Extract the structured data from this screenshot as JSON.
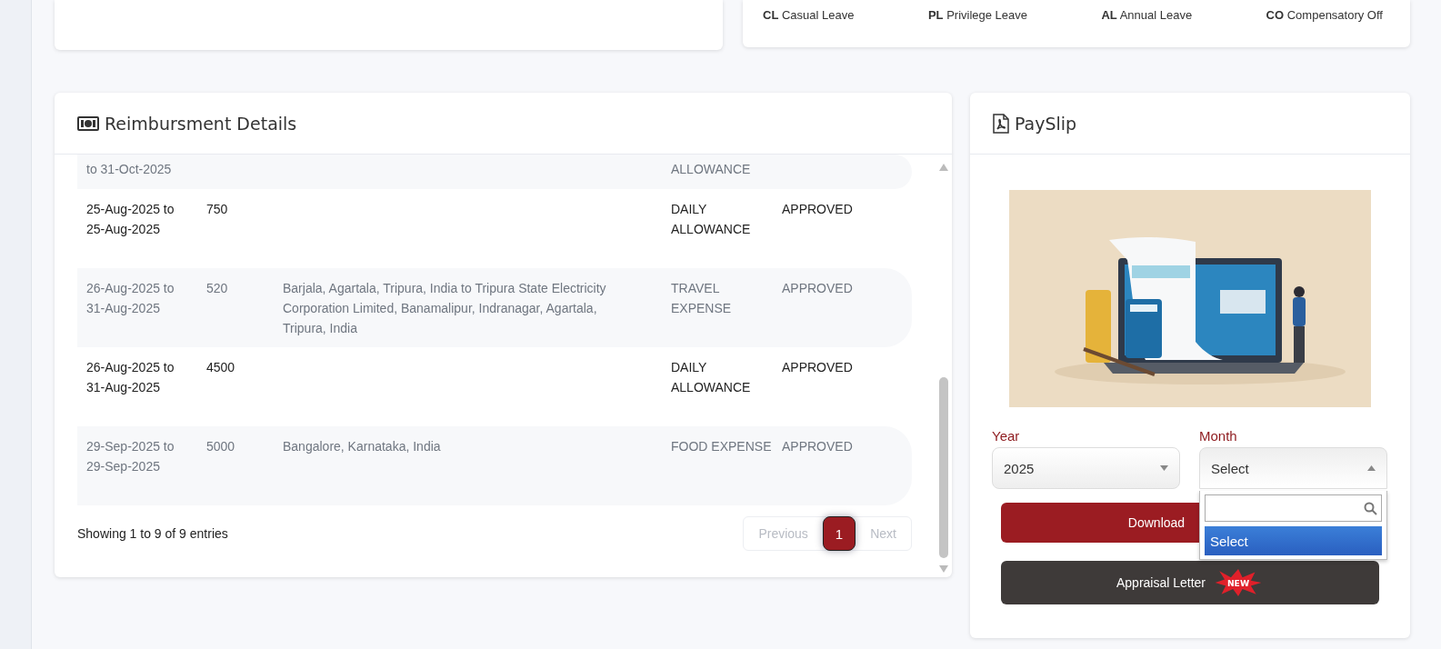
{
  "leave_legend": [
    {
      "text": "**CL** Casual Leave"
    },
    {
      "text": "**PL** Privilege Leave"
    },
    {
      "text": "**AL** Annual Leave"
    },
    {
      "text": "**CO** Compensatory Off"
    }
  ],
  "reimbursement": {
    "title": "Reimbursment Details",
    "rows": [
      {
        "date": "to 31-Oct-2025",
        "type": "ALLOWANCE"
      },
      {
        "date": "25-Aug-2025 to 25-Aug-2025",
        "amount": "750",
        "type": "DAILY ALLOWANCE",
        "status": "APPROVED"
      },
      {
        "date": "26-Aug-2025 to 31-Aug-2025",
        "amount": "520",
        "location": "Barjala, Agartala, Tripura, India to Tripura State Electricity Corporation Limited, Banamalipur, Indranagar, Agartala, Tripura, India",
        "type": "TRAVEL EXPENSE",
        "status": "APPROVED"
      },
      {
        "date": "26-Aug-2025 to 31-Aug-2025",
        "amount": "4500",
        "type": "DAILY ALLOWANCE",
        "status": "APPROVED"
      },
      {
        "date": "29-Sep-2025 to 29-Sep-2025",
        "amount": "5000",
        "location": "Bangalore, Karnataka, India",
        "type": "FOOD EXPENSE",
        "status": "APPROVED"
      }
    ],
    "footer": "Showing 1 to 9 of 9 entries",
    "pagination": [
      {
        "label": "Previous",
        "selected": false,
        "disabled": true
      },
      {
        "label": "1",
        "selected": true,
        "disabled": false
      },
      {
        "label": "Next",
        "selected": false,
        "disabled": true
      }
    ]
  },
  "payslip": {
    "title": "PaySlip",
    "year": {
      "label": "Year",
      "value": "2025",
      "expanded": false
    },
    "month": {
      "label": "Month",
      "value": "Select",
      "expanded": true,
      "options": [
        {
          "label": "Select",
          "selected": true
        }
      ]
    },
    "buttons": [
      {
        "label": "Download",
        "kind": "primary"
      },
      {
        "label": "Appraisal Letter",
        "kind": "dark",
        "badge": "NEW"
      }
    ]
  }
}
